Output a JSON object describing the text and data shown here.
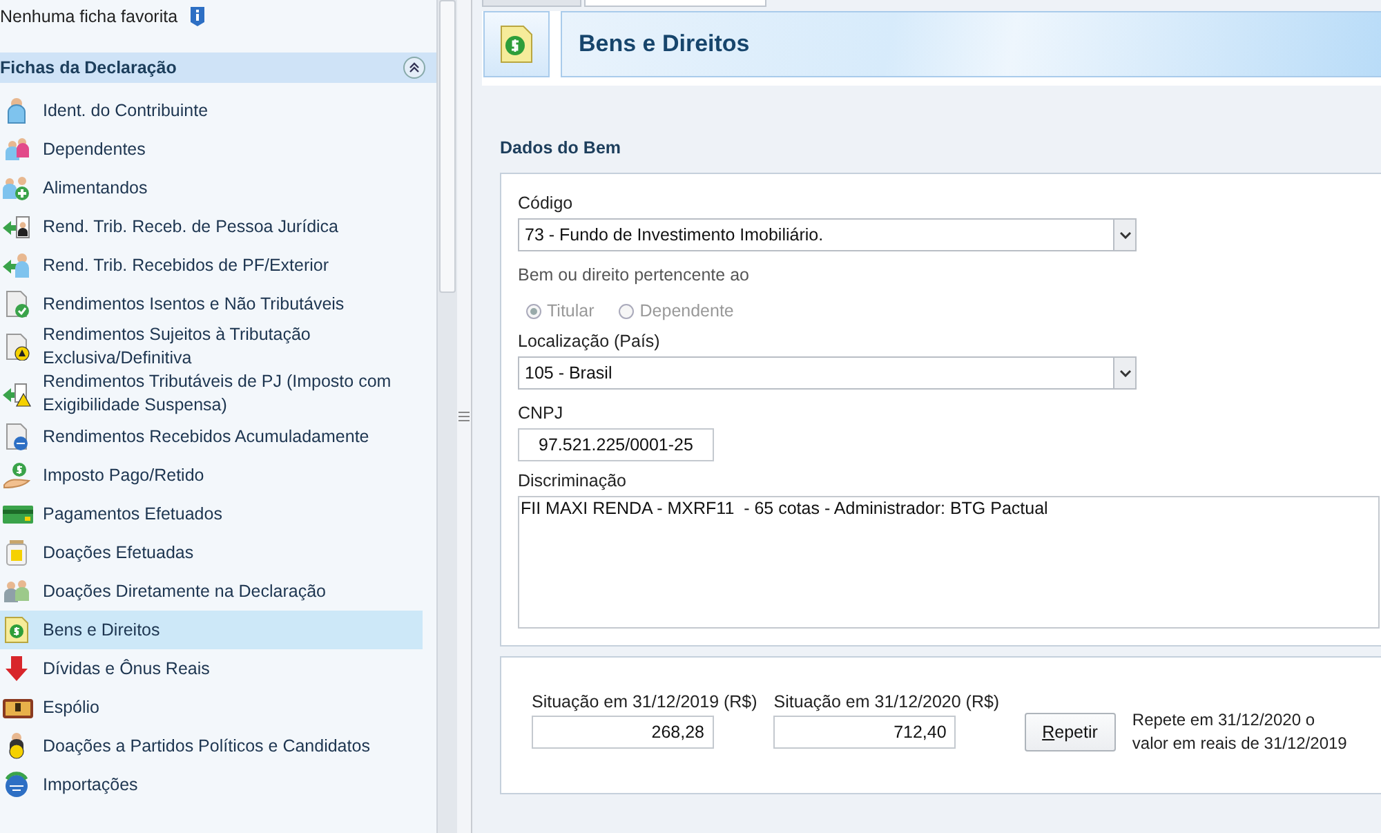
{
  "favorites": {
    "text": "Nenhuma ficha favorita"
  },
  "sidebar": {
    "title": "Fichas da Declaração",
    "expanded": true,
    "items": [
      {
        "label": "Ident. do Contribuinte",
        "selected": false
      },
      {
        "label": "Dependentes",
        "selected": false
      },
      {
        "label": "Alimentandos",
        "selected": false
      },
      {
        "label": "Rend. Trib. Receb. de Pessoa Jurídica",
        "selected": false
      },
      {
        "label": "Rend. Trib. Recebidos de PF/Exterior",
        "selected": false
      },
      {
        "label": "Rendimentos Isentos e Não Tributáveis",
        "selected": false
      },
      {
        "label": "Rendimentos Sujeitos à Tributação Exclusiva/Definitiva",
        "selected": false
      },
      {
        "label": "Rendimentos Tributáveis de PJ (Imposto com Exigibilidade Suspensa)",
        "selected": false
      },
      {
        "label": "Rendimentos Recebidos Acumuladamente",
        "selected": false
      },
      {
        "label": "Imposto Pago/Retido",
        "selected": false
      },
      {
        "label": "Pagamentos Efetuados",
        "selected": false
      },
      {
        "label": "Doações Efetuadas",
        "selected": false
      },
      {
        "label": "Doações Diretamente na Declaração",
        "selected": false
      },
      {
        "label": "Bens e Direitos",
        "selected": true
      },
      {
        "label": "Dívidas e Ônus Reais",
        "selected": false
      },
      {
        "label": "Espólio",
        "selected": false
      },
      {
        "label": "Doações a Partidos Políticos e Candidatos",
        "selected": false
      },
      {
        "label": "Importações",
        "selected": false
      }
    ]
  },
  "page": {
    "title": "Bens e Direitos"
  },
  "form": {
    "section": "Dados do Bem",
    "codigo": {
      "label": "Código",
      "value": "73 - Fundo de Investimento Imobiliário."
    },
    "ownership": {
      "label": "Bem ou direito pertencente ao",
      "disabled": true,
      "options": [
        {
          "label": "Titular",
          "selected": true
        },
        {
          "label": "Dependente",
          "selected": false
        }
      ]
    },
    "localizacao": {
      "label": "Localização (País)",
      "value": "105 - Brasil"
    },
    "cnpj": {
      "label": "CNPJ",
      "value": "97.521.225/0001-25"
    },
    "discriminacao": {
      "label": "Discriminação",
      "value": "FII MAXI RENDA - MXRF11  - 65 cotas - Administrador: BTG Pactual"
    }
  },
  "values": {
    "fields": [
      {
        "label": "Situação em 31/12/2019 (R$)",
        "value": "268,28"
      },
      {
        "label": "Situação em 31/12/2020 (R$)",
        "value": "712,40"
      }
    ],
    "button": {
      "label": "Repetir",
      "mnemonic": true
    },
    "hint": "Repete em 31/12/2020 o valor em reais de 31/12/2019"
  }
}
